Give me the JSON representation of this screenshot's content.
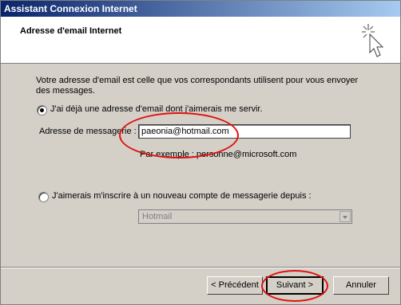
{
  "window": {
    "title": "Assistant Connexion Internet"
  },
  "header": {
    "title": "Adresse d'email Internet"
  },
  "intro": {
    "text": "Votre adresse d'email est celle que vos correspondants utilisent pour vous envoyer des messages."
  },
  "option_existing": {
    "label": "J'ai déjà une adresse d'email dont j'aimerais me servir.",
    "checked": true
  },
  "email_field": {
    "label": "Adresse de messagerie :",
    "value": "paeonia@hotmail.com",
    "example": "Par exemple : personne@microsoft.com"
  },
  "option_new": {
    "label": "J'aimerais m'inscrire à un nouveau compte de messagerie depuis :",
    "checked": false
  },
  "provider_select": {
    "value": "Hotmail"
  },
  "buttons": {
    "back": "< Précédent",
    "next": "Suivant >",
    "cancel": "Annuler"
  },
  "colors": {
    "titlebar_start": "#0a246a",
    "titlebar_end": "#a6caf0",
    "dialog_bg": "#d4d0c8",
    "annotation": "#e01010"
  }
}
